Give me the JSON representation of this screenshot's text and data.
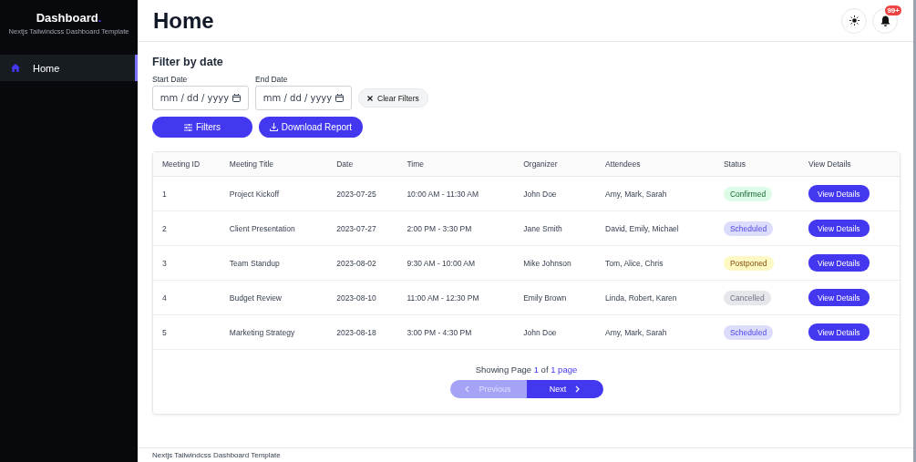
{
  "sidebar": {
    "brand": "Dashboard",
    "brand_dot": ".",
    "subtitle": "Nextjs Tailwindcss Dashboard Template",
    "items": [
      {
        "label": "Home",
        "selected": true
      }
    ]
  },
  "header": {
    "title": "Home",
    "notification_badge": "99+"
  },
  "filter": {
    "heading": "Filter by date",
    "start_label": "Start Date",
    "start_placeholder": "mm / dd / yyyy",
    "end_label": "End Date",
    "end_placeholder": "mm / dd / yyyy",
    "clear_button": "Clear Filters",
    "filters_button": "Filters",
    "download_button": "Download Report"
  },
  "table": {
    "columns": [
      "Meeting ID",
      "Meeting Title",
      "Date",
      "Time",
      "Organizer",
      "Attendees",
      "Status",
      "View Details"
    ],
    "rows": [
      {
        "id": "1",
        "title": "Project Kickoff",
        "date": "2023-07-25",
        "time": "10:00 AM - 11:30 AM",
        "organizer": "John Doe",
        "attendees": "Amy, Mark, Sarah",
        "status": "Confirmed",
        "kind": "confirmed",
        "action": "View Details"
      },
      {
        "id": "2",
        "title": "Client Presentation",
        "date": "2023-07-27",
        "time": "2:00 PM - 3:30 PM",
        "organizer": "Jane Smith",
        "attendees": "David, Emily, Michael",
        "status": "Scheduled",
        "kind": "scheduled",
        "action": "View Details"
      },
      {
        "id": "3",
        "title": "Team Standup",
        "date": "2023-08-02",
        "time": "9:30 AM - 10:00 AM",
        "organizer": "Mike Johnson",
        "attendees": "Tom, Alice, Chris",
        "status": "Postponed",
        "kind": "postponed",
        "action": "View Details"
      },
      {
        "id": "4",
        "title": "Budget Review",
        "date": "2023-08-10",
        "time": "11:00 AM - 12:30 PM",
        "organizer": "Emily Brown",
        "attendees": "Linda, Robert, Karen",
        "status": "Cancelled",
        "kind": "cancelled",
        "action": "View Details"
      },
      {
        "id": "5",
        "title": "Marketing Strategy",
        "date": "2023-08-18",
        "time": "3:00 PM - 4:30 PM",
        "organizer": "John Doe",
        "attendees": "Amy, Mark, Sarah",
        "status": "Scheduled",
        "kind": "scheduled",
        "action": "View Details"
      }
    ]
  },
  "pagination": {
    "showing": "Showing Page **1** of **1 page**",
    "previous": "Previous",
    "previous_disabled": true,
    "next": "Next",
    "next_disabled": false
  },
  "footer": "Nextjs Tailwindcss Dashboard Template"
}
